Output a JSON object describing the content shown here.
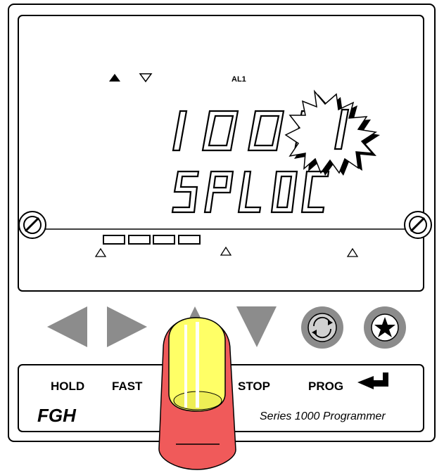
{
  "display": {
    "upper_readout": "10001",
    "lower_readout": "SPLOC",
    "alarm_label": "AL1",
    "blinking_digit": "1"
  },
  "keypad": {
    "left_key": "left-arrow",
    "right_key": "right-arrow",
    "up_key": "up-arrow",
    "down_key": "down-arrow",
    "cycle_key": "cycle",
    "star_key": "star"
  },
  "legend": {
    "hold": "HOLD",
    "fast": "FAST",
    "stop": "STOP",
    "prog": "PROG",
    "brand": "FGH",
    "series": "Series 1000 Programmer"
  },
  "colors": {
    "panel_outline": "#000000",
    "key_grey": "#8c8c8c",
    "finger_red": "#f05a5a",
    "fingernail_yellow": "#ffff66"
  }
}
